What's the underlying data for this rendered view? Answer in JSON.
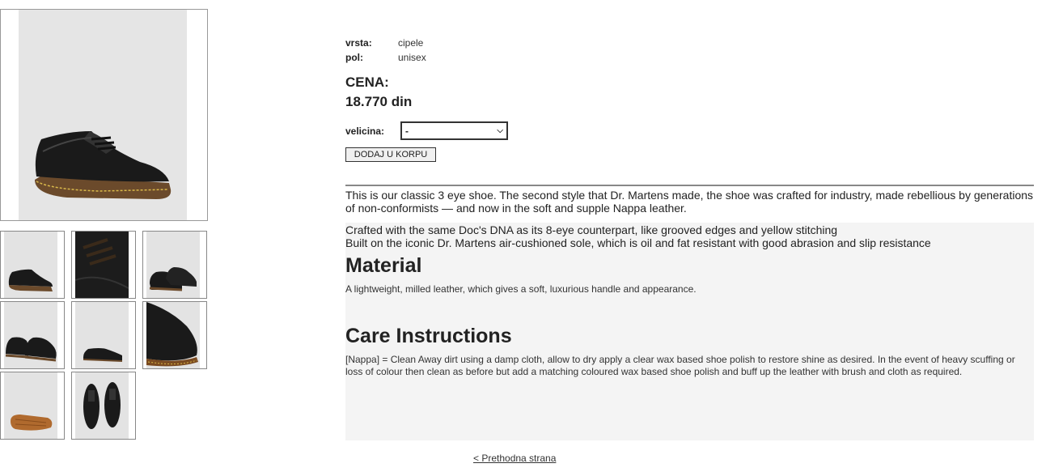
{
  "product": {
    "attributes": [
      {
        "label": "vrsta:",
        "value": "cipele"
      },
      {
        "label": "pol:",
        "value": "unisex"
      }
    ],
    "price_label": "CENA:",
    "price_value": "18.770 din",
    "size_label": "velicina:",
    "size_selected": "-",
    "add_to_cart": "DODAJ U KORPU"
  },
  "description": {
    "intro": "This is our classic 3 eye shoe. The second style that Dr. Martens made, the shoe was crafted for industry, made rebellious by generations of non-conformists — and now in the soft and supple Nappa leather.",
    "features": [
      "Crafted with the same Doc's DNA as its 8-eye counterpart, like grooved edges and yellow stitching",
      "Built on the iconic Dr. Martens air-cushioned sole, which is oil and fat resistant with good abrasion and slip resistance"
    ],
    "material_heading": "Material",
    "material_text": "A lightweight, milled leather, which gives a soft, luxurious handle and appearance.",
    "care_heading": "Care Instructions",
    "care_text": "[Nappa] = Clean Away dirt using a damp cloth, allow to dry apply a clear wax based shoe polish to restore shine as desired. In the event of heavy scuffing or loss of colour then clean as before but add a matching coloured wax based shoe polish and buff up the leather with brush and cloth as required."
  },
  "navigation": {
    "previous_page": "< Prethodna strana"
  },
  "colors": {
    "image_background": "#e5e5e5",
    "description_box": "#f4f4f4",
    "shoe_leather": "#1a1a1a",
    "shoe_sole": "#6b4a2b",
    "stitching": "#d8b84a"
  }
}
